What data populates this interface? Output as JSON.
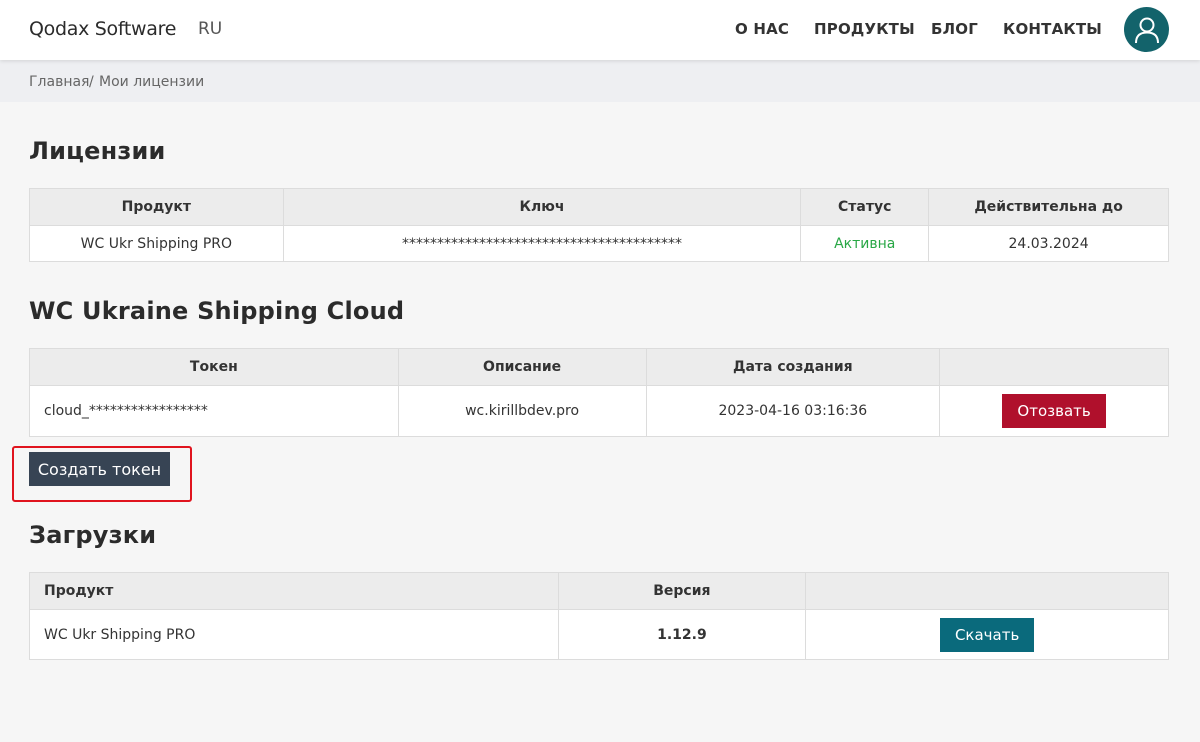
{
  "header": {
    "brand": "Qodax Software",
    "lang": "RU",
    "nav": [
      "О НАС",
      "ПРОДУКТЫ",
      "БЛОГ",
      "КОНТАКТЫ"
    ],
    "avatar_icon": "user-icon"
  },
  "breadcrumb": {
    "home": "Главная",
    "separator": "/",
    "current": "Мои лицензии"
  },
  "licenses": {
    "title": "Лицензии",
    "columns": [
      "Продукт",
      "Ключ",
      "Статус",
      "Действительна до"
    ],
    "rows": [
      {
        "product": "WC Ukr Shipping PRO",
        "key": "****************************************",
        "status": "Активна",
        "valid_until": "24.03.2024"
      }
    ]
  },
  "cloud": {
    "title": "WC Ukraine Shipping Cloud",
    "columns": [
      "Токен",
      "Описание",
      "Дата создания",
      ""
    ],
    "rows": [
      {
        "token": "cloud_*****************",
        "description": "wc.kirillbdev.pro",
        "created": "2023-04-16 03:16:36",
        "revoke_label": "Отозвать"
      }
    ],
    "create_label": "Создать токен"
  },
  "downloads": {
    "title": "Загрузки",
    "columns": [
      "Продукт",
      "Версия",
      ""
    ],
    "rows": [
      {
        "product": "WC Ukr Shipping PRO",
        "version": "1.12.9",
        "download_label": "Скачать"
      }
    ]
  },
  "colors": {
    "status_active": "#28a745",
    "revoke": "#b0102c",
    "download": "#0a6a7c",
    "create": "#374454",
    "highlight": "#e0141e",
    "avatar": "#13636b"
  }
}
